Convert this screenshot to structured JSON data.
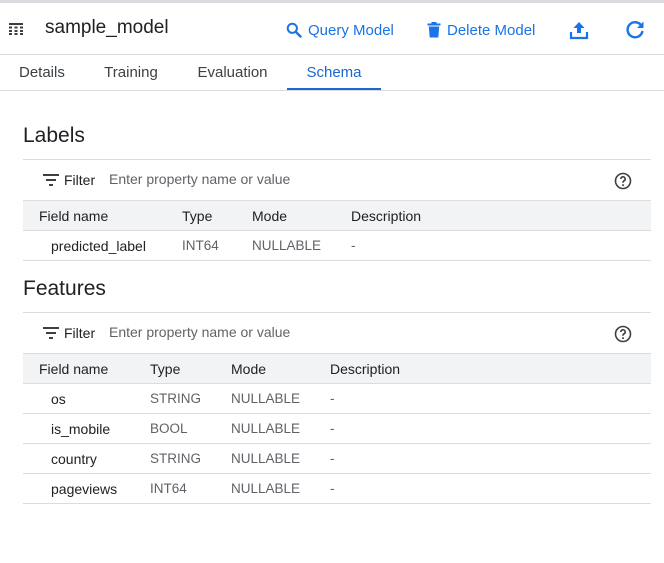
{
  "header": {
    "title": "sample_model",
    "query_label": "Query Model",
    "delete_label": "Delete Model",
    "accent": "#1a73e8"
  },
  "tabs": [
    {
      "label": "Details",
      "active": false
    },
    {
      "label": "Training",
      "active": false
    },
    {
      "label": "Evaluation",
      "active": false
    },
    {
      "label": "Schema",
      "active": true
    }
  ],
  "labels_section": {
    "title": "Labels",
    "filter_label": "Filter",
    "filter_placeholder": "Enter property name or value",
    "columns": [
      "Field name",
      "Type",
      "Mode",
      "Description"
    ],
    "rows": [
      {
        "name": "predicted_label",
        "type": "INT64",
        "mode": "NULLABLE",
        "description": "-"
      }
    ]
  },
  "features_section": {
    "title": "Features",
    "filter_label": "Filter",
    "filter_placeholder": "Enter property name or value",
    "columns": [
      "Field name",
      "Type",
      "Mode",
      "Description"
    ],
    "rows": [
      {
        "name": "os",
        "type": "STRING",
        "mode": "NULLABLE",
        "description": "-"
      },
      {
        "name": "is_mobile",
        "type": "BOOL",
        "mode": "NULLABLE",
        "description": "-"
      },
      {
        "name": "country",
        "type": "STRING",
        "mode": "NULLABLE",
        "description": "-"
      },
      {
        "name": "pageviews",
        "type": "INT64",
        "mode": "NULLABLE",
        "description": "-"
      }
    ]
  },
  "icons": [
    "model-icon",
    "search-icon",
    "trash-icon",
    "export-icon",
    "refresh-icon",
    "filter-icon",
    "help-icon"
  ]
}
